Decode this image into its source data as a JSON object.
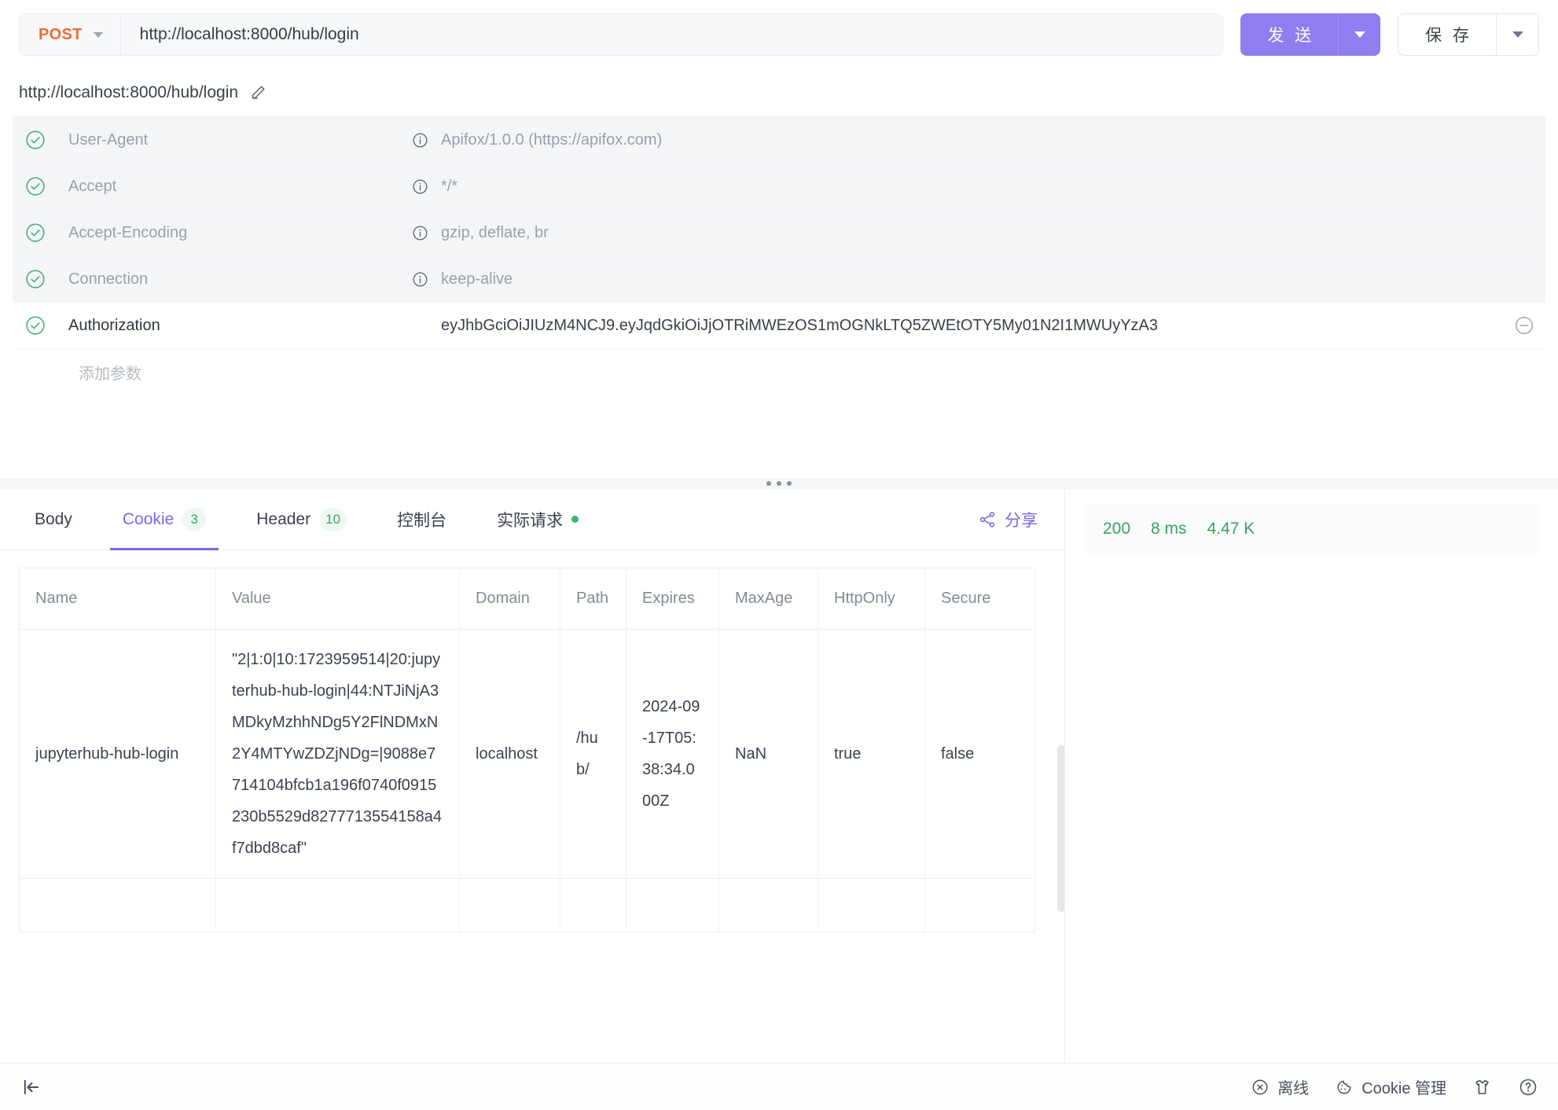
{
  "request": {
    "method": "POST",
    "url": "http://localhost:8000/hub/login",
    "send_label": "发 送",
    "save_label": "保 存"
  },
  "subtitle": {
    "title": "http://localhost:8000/hub/login",
    "edit_icon": "pencil-icon"
  },
  "headers": {
    "add_param_label": "添加参数",
    "rows": [
      {
        "enabled": true,
        "name": "User-Agent",
        "value": "Apifox/1.0.0 (https://apifox.com)",
        "has_info": true,
        "dim": true
      },
      {
        "enabled": true,
        "name": "Accept",
        "value": "*/*",
        "has_info": true,
        "dim": true
      },
      {
        "enabled": true,
        "name": "Accept-Encoding",
        "value": "gzip, deflate, br",
        "has_info": true,
        "dim": true
      },
      {
        "enabled": true,
        "name": "Connection",
        "value": "keep-alive",
        "has_info": true,
        "dim": true
      },
      {
        "enabled": true,
        "name": "Authorization",
        "value": "eyJhbGciOiJIUzM4NCJ9.eyJqdGkiOiJjOTRiMWEzOS1mOGNkLTQ5ZWEtOTY5My01N2I1MWUyYzA3",
        "has_info": false,
        "dim": false
      }
    ]
  },
  "tabs": [
    {
      "label": "Body",
      "badge": "",
      "active": false,
      "dot": false
    },
    {
      "label": "Cookie",
      "badge": "3",
      "active": true,
      "dot": false
    },
    {
      "label": "Header",
      "badge": "10",
      "active": false,
      "dot": false
    },
    {
      "label": "控制台",
      "badge": "",
      "active": false,
      "dot": false
    },
    {
      "label": "实际请求",
      "badge": "",
      "active": false,
      "dot": true
    }
  ],
  "share": {
    "label": "分享",
    "icon": "share-icon"
  },
  "response_status": {
    "code": "200",
    "time": "8 ms",
    "size": "4.47 K"
  },
  "cookie_table": {
    "columns": [
      "Name",
      "Value",
      "Domain",
      "Path",
      "Expires",
      "MaxAge",
      "HttpOnly",
      "Secure"
    ],
    "rows": [
      {
        "name": "jupyterhub-hub-login",
        "value": "\"2|1:0|10:1723959514|20:jupyterhub-hub-login|44:NTJiNjA3MDkyMzhhNDg5Y2FlNDMxN2Y4MTYwZDZjNDg=|9088e7714104bfcb1a196f0740f0915230b5529d8277713554158a4f7dbd8caf\"",
        "domain": "localhost",
        "path": "/hub/",
        "expires": "2024-09-17T05:38:34.000Z",
        "maxage": "NaN",
        "httponly": "true",
        "secure": "false"
      }
    ]
  },
  "bottombar": {
    "collapse_icon": "collapse-left-icon",
    "offline_label": "离线",
    "cookie_manage_label": "Cookie 管理",
    "theme_icon": "shirt-icon",
    "help_icon": "help-circle-icon"
  },
  "colors": {
    "accent": "#7a66ea",
    "send": "#8e7ef0",
    "method": "#ef6a32",
    "success": "#34a45f"
  }
}
